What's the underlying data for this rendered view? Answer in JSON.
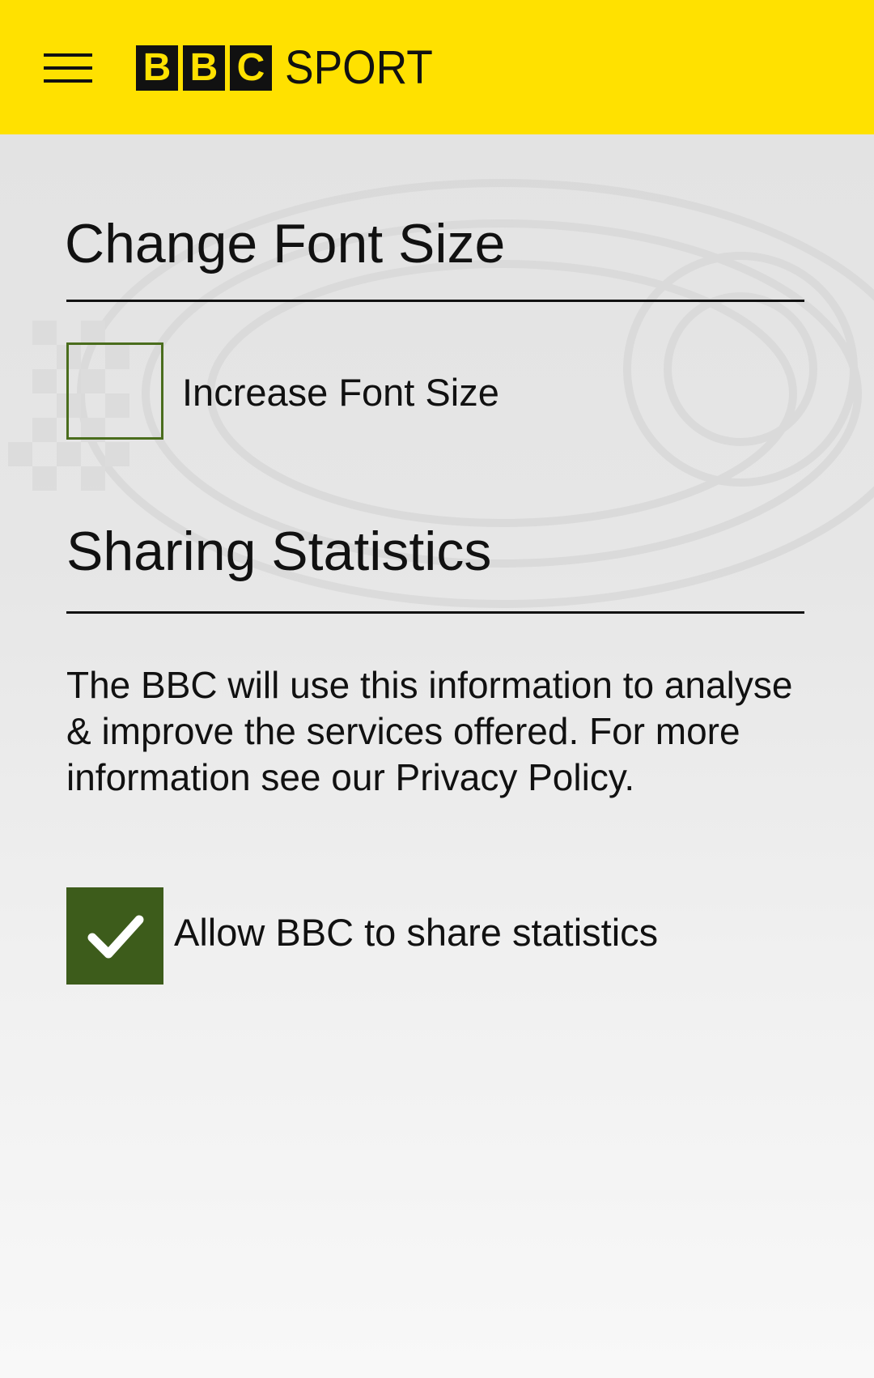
{
  "header": {
    "logo_letters": [
      "B",
      "B",
      "C"
    ],
    "logo_word": "SPORT",
    "brand_color": "#ffe100"
  },
  "font_size": {
    "title": "Change Font Size",
    "checkbox_label": "Increase Font Size",
    "checked": false
  },
  "sharing": {
    "title": "Sharing Statistics",
    "description": "The BBC will use this information to analyse & improve the services offered. For more information see our Privacy Policy.",
    "checkbox_label": "Allow BBC to share statistics",
    "checked": true,
    "check_color": "#3d5c1b"
  },
  "icons": {
    "menu": "hamburger-menu-icon",
    "check": "checkmark-icon"
  }
}
